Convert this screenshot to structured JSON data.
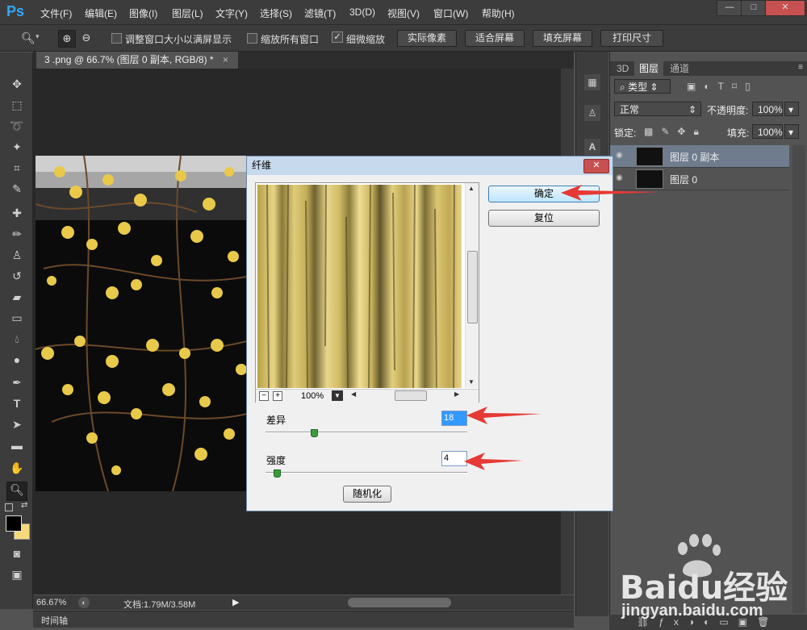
{
  "menubar": {
    "app_logo": "Ps",
    "items": [
      "文件(F)",
      "编辑(E)",
      "图像(I)",
      "图层(L)",
      "文字(Y)",
      "选择(S)",
      "滤镜(T)",
      "3D(D)",
      "视图(V)",
      "窗口(W)",
      "帮助(H)"
    ]
  },
  "options": {
    "resize_windows_label": "调整窗口大小以满屏显示",
    "zoom_all_label": "缩放所有窗口",
    "scrubby_zoom_label": "细微缩放",
    "actual_pixels": "实际像素",
    "fit_screen": "适合屏幕",
    "fill_screen": "填充屏幕",
    "print_size": "打印尺寸"
  },
  "document": {
    "tab_title": "3 .png @ 66.7% (图层 0 副本, RGB/8) *",
    "close_glyph": "×"
  },
  "statusbar": {
    "zoom": "66.67%",
    "doc_info": "文档:1.79M/3.58M"
  },
  "timeline": {
    "label": "时间轴"
  },
  "panel": {
    "tabs": [
      "3D",
      "图层",
      "通道"
    ],
    "active_tab": "图层",
    "kind_filter": "类型",
    "blend_mode": "正常",
    "opacity_label": "不透明度:",
    "opacity_value": "100%",
    "lock_label": "锁定:",
    "fill_label": "填充:",
    "fill_value": "100%",
    "layers": [
      {
        "name": "图层 0 副本",
        "selected": true
      },
      {
        "name": "图层 0",
        "selected": false
      }
    ]
  },
  "dialog": {
    "title": "纤维",
    "close_glyph": "✕",
    "ok_button": "确定",
    "reset_button": "复位",
    "preview_zoom": "100%",
    "variance_label": "差异",
    "variance_value": "18",
    "strength_label": "强度",
    "strength_value": "4",
    "randomize_button": "随机化"
  },
  "watermark": {
    "brand": "Baidu经验",
    "url": "jingyan.baidu.com"
  },
  "colors": {
    "foreground": "#000000",
    "background": "#f5d97a",
    "annotation_arrow": "#e53935"
  }
}
